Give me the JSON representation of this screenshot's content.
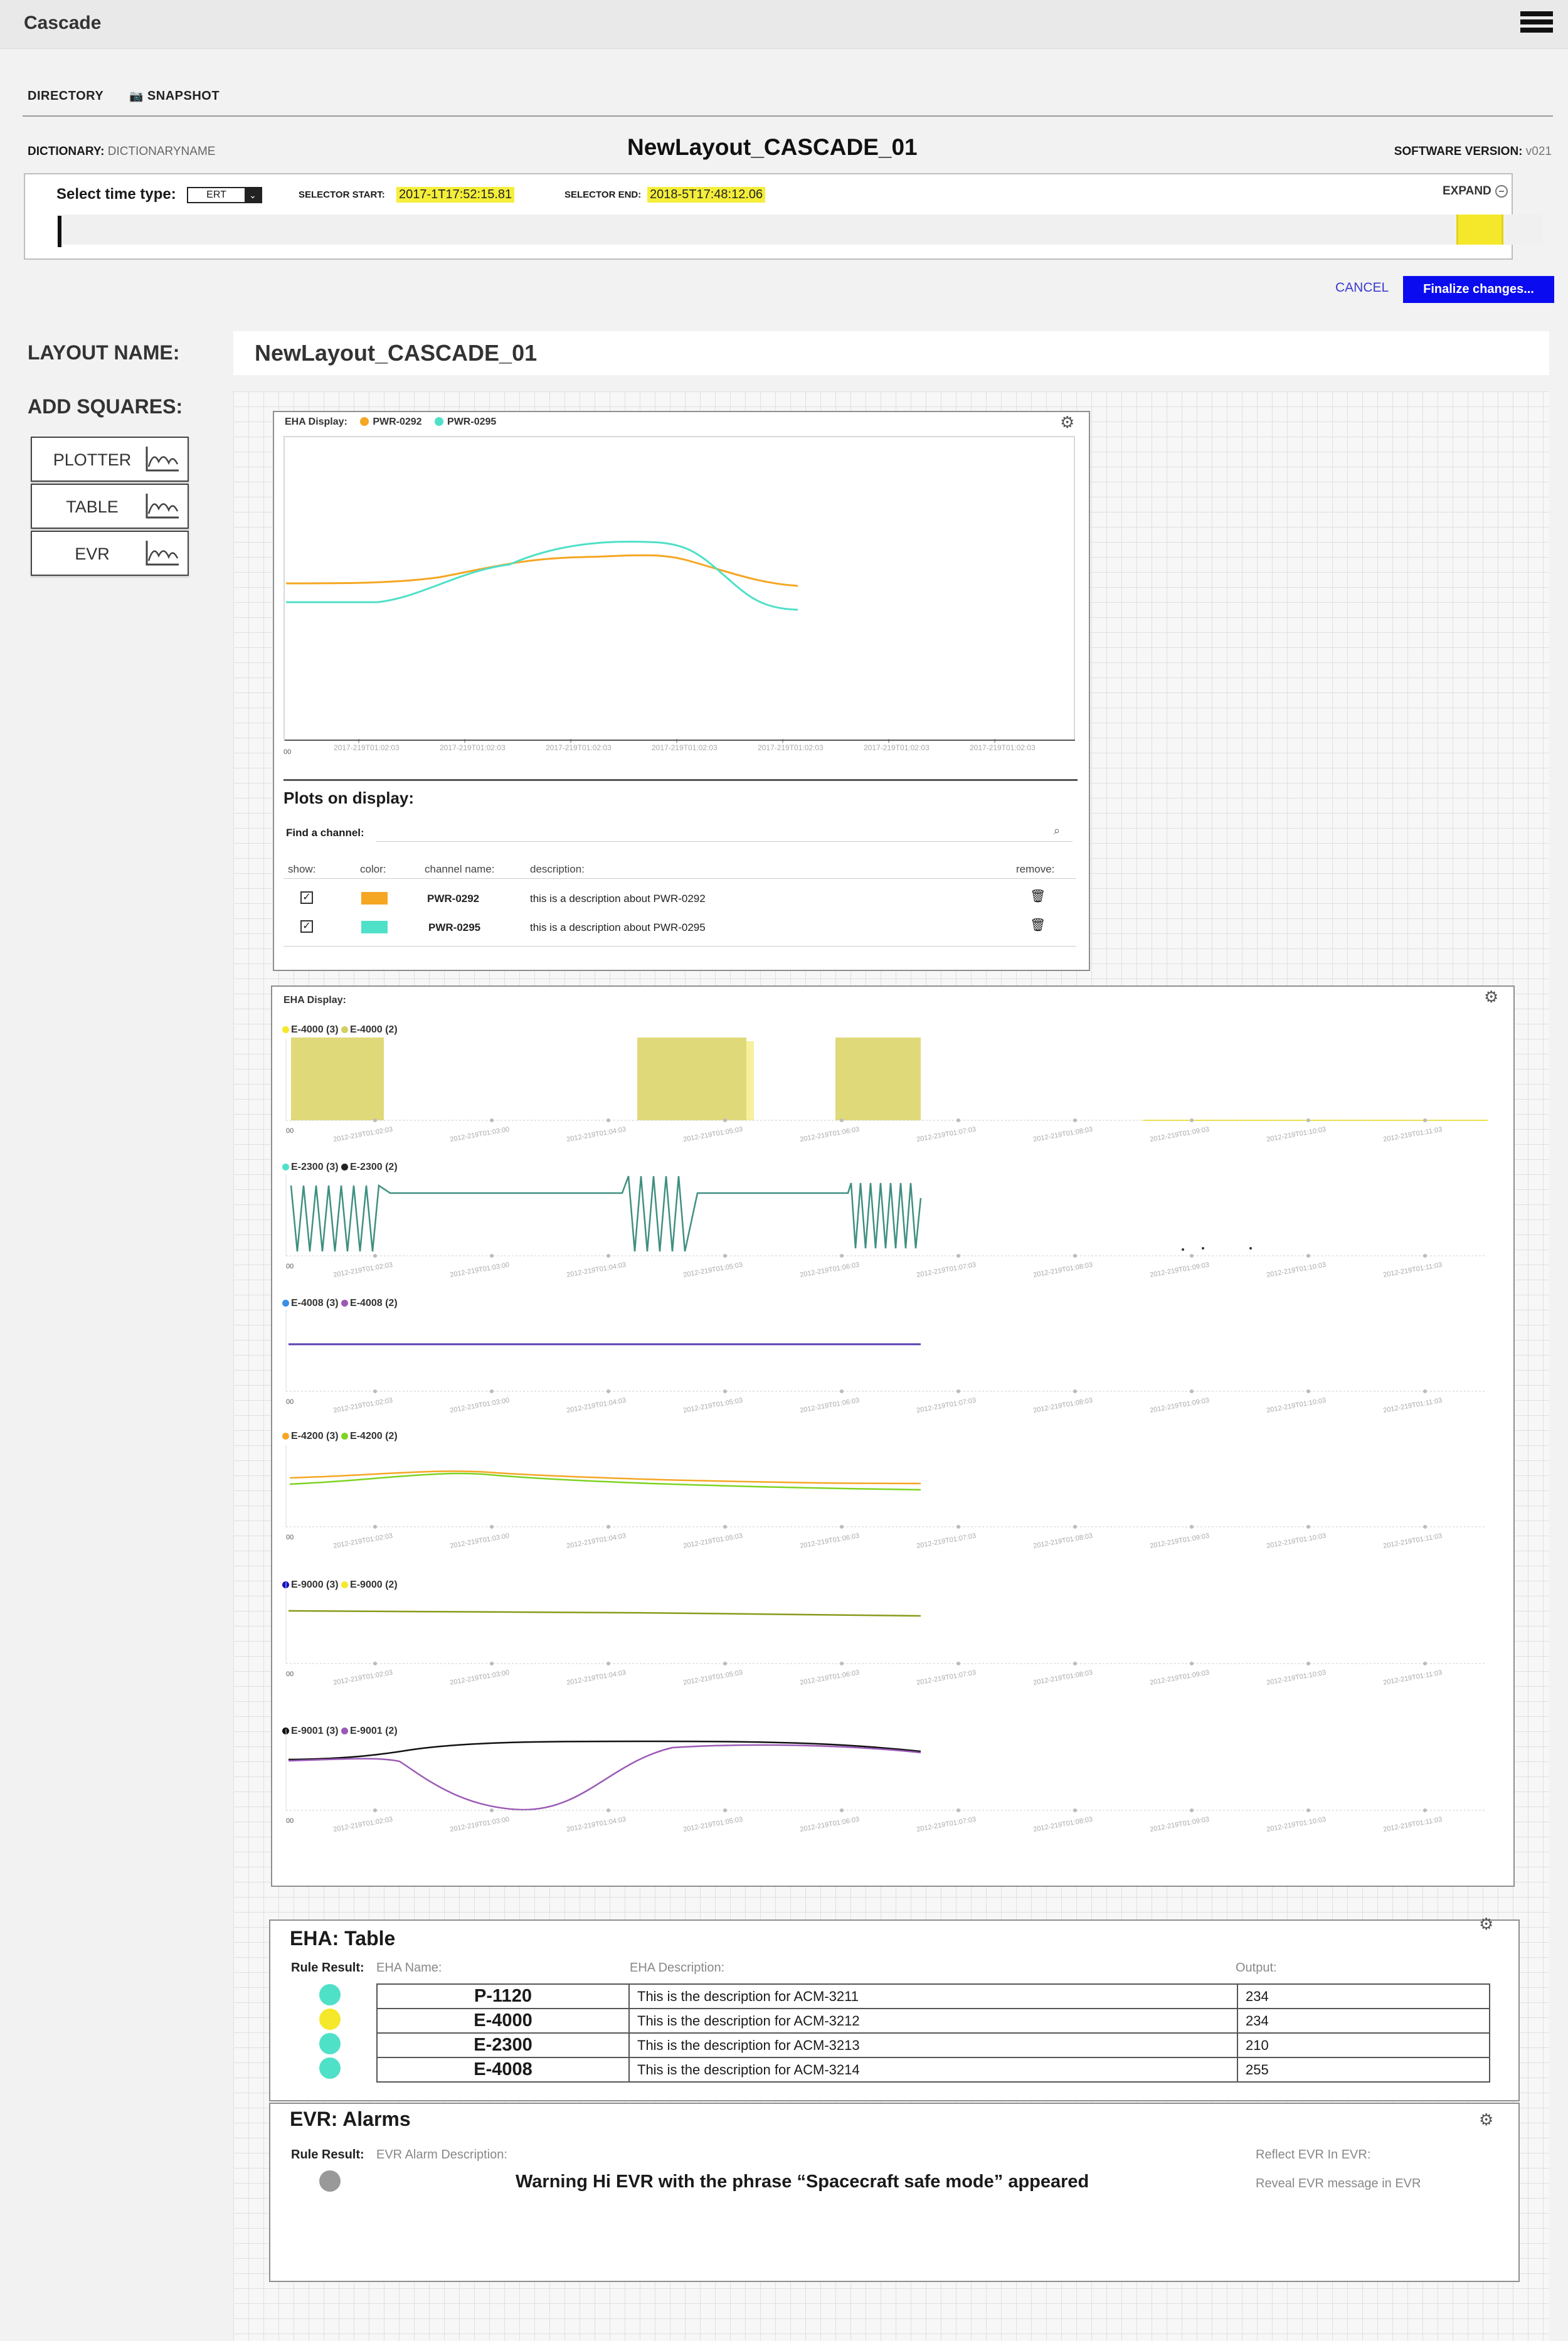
{
  "app": {
    "title": "Cascade"
  },
  "nav": {
    "directory": "DIRECTORY",
    "snapshot": "SNAPSHOT"
  },
  "header": {
    "dictionary_label": "DICTIONARY:",
    "dictionary_value": "DICTIONARYNAME",
    "layout_title": "NewLayout_CASCADE_01",
    "software_label": "SOFTWARE VERSION:",
    "software_value": "v021"
  },
  "time_selector": {
    "label": "Select time type:",
    "type_value": "ERT",
    "start_label": "SELECTOR START:",
    "start_value": "2017-1T17:52:15.81",
    "end_label": "SELECTOR END:",
    "end_value": "2018-5T17:48:12.06",
    "expand_label": "EXPAND"
  },
  "actions": {
    "cancel": "CANCEL",
    "finalize": "Finalize changes..."
  },
  "layout_name": {
    "label": "LAYOUT NAME:",
    "value": "NewLayout_CASCADE_01"
  },
  "add_squares": {
    "label": "ADD SQUARES:",
    "buttons": [
      {
        "label": "PLOTTER",
        "icon": "chart-icon"
      },
      {
        "label": "TABLE",
        "icon": "chart-icon"
      },
      {
        "label": "EVR",
        "icon": "chart-icon"
      }
    ]
  },
  "plotter1": {
    "display_label": "EHA Display:",
    "series": [
      {
        "name": "PWR-0292",
        "color": "#f5a623"
      },
      {
        "name": "PWR-0295",
        "color": "#4fe0c8"
      }
    ],
    "x_tick_label": "2017-219T01:02:03",
    "x_origin": "00",
    "plots_title": "Plots on display:",
    "find_label": "Find a channel:",
    "columns": {
      "show": "show:",
      "color": "color:",
      "channel": "channel name:",
      "description": "description:",
      "remove": "remove:"
    },
    "rows": [
      {
        "channel": "PWR-0292",
        "description": "this is a description about PWR-0292",
        "color": "#f5a623"
      },
      {
        "channel": "PWR-0295",
        "description": "this is a description about PWR-0295",
        "color": "#4fe0c8"
      }
    ]
  },
  "plotter2": {
    "display_label": "EHA Display:",
    "x_origin": "00",
    "x_ticks": [
      "2012-219T01:02:03",
      "2012-219T01:03:00",
      "2012-219T01:04:03",
      "2012-219T01:05:03",
      "2012-219T01:06:03",
      "2012-219T01:07:03",
      "2012-219T01:08:03",
      "2012-219T01:09:03",
      "2012-219T01:10:03",
      "2012-219T01:11:03"
    ],
    "rows": [
      {
        "legend": [
          {
            "name": "E-4000 (3)",
            "color": "#f5e82a"
          },
          {
            "name": "E-4000 (2)",
            "color": "#d4cf60"
          }
        ]
      },
      {
        "legend": [
          {
            "name": "E-2300 (3)",
            "color": "#4fe0c8"
          },
          {
            "name": "E-2300 (2)",
            "color": "#222222"
          }
        ]
      },
      {
        "legend": [
          {
            "name": "E-4008 (3)",
            "color": "#3a8ee6"
          },
          {
            "name": "E-4008 (2)",
            "color": "#9b59b6"
          }
        ]
      },
      {
        "legend": [
          {
            "name": "E-4200 (3)",
            "color": "#f5a623"
          },
          {
            "name": "E-4200 (2)",
            "color": "#7ed321"
          }
        ]
      },
      {
        "legend": [
          {
            "name": "E-9000 (3)",
            "color": "#1010c0"
          },
          {
            "name": "E-9000 (2)",
            "color": "#f5e82a"
          }
        ]
      },
      {
        "legend": [
          {
            "name": "E-9001 (3)",
            "color": "#111111"
          },
          {
            "name": "E-9001 (2)",
            "color": "#9b59b6"
          }
        ]
      }
    ]
  },
  "eha_table": {
    "title": "EHA: Table",
    "rule_label": "Rule Result:",
    "headers": {
      "name": "EHA Name:",
      "description": "EHA Description:",
      "output": "Output:"
    },
    "rows": [
      {
        "status_color": "#4fe0c8",
        "name": "P-1120",
        "description": "This is the description for ACM-3211",
        "output": "234"
      },
      {
        "status_color": "#f5e82a",
        "name": "E-4000",
        "description": "This is the description for ACM-3212",
        "output": "234"
      },
      {
        "status_color": "#4fe0c8",
        "name": "E-2300",
        "description": "This is the description for ACM-3213",
        "output": "210"
      },
      {
        "status_color": "#4fe0c8",
        "name": "E-4008",
        "description": "This is the description for ACM-3214",
        "output": "255"
      }
    ]
  },
  "evr": {
    "title": "EVR: Alarms",
    "rule_label": "Rule Result:",
    "desc_header": "EVR Alarm Description:",
    "reflect_header": "Reflect EVR In EVR:",
    "message": "Warning Hi EVR with the phrase “Spacecraft safe mode” appeared",
    "reveal": "Reveal EVR message in EVR",
    "status_color": "#999999"
  }
}
